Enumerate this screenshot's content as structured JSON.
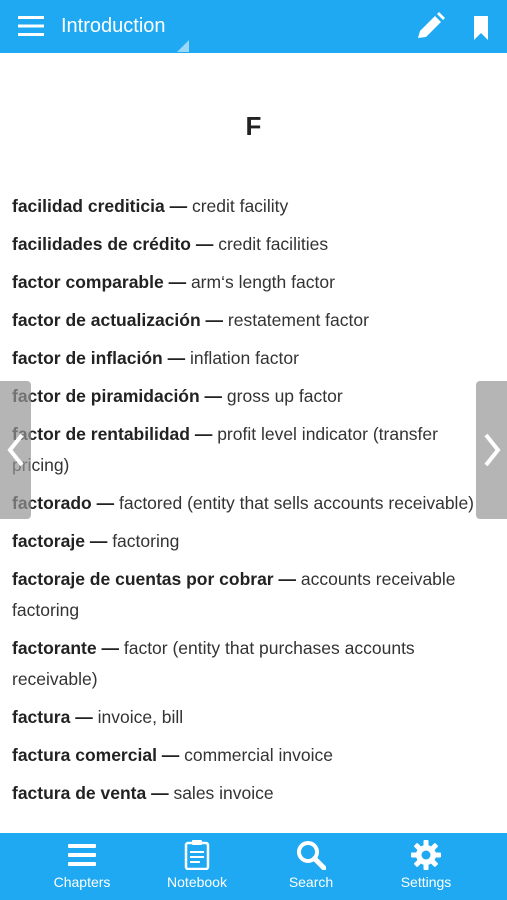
{
  "header": {
    "title": "Introduction"
  },
  "content": {
    "section_letter": "F",
    "entries": [
      {
        "term": "facilidad crediticia",
        "definition": "credit facility"
      },
      {
        "term": "facilidades de crédito",
        "definition": "credit facilities"
      },
      {
        "term": "factor comparable",
        "definition": "arm‘s length factor"
      },
      {
        "term": "factor de actualización",
        "definition": "restatement factor"
      },
      {
        "term": "factor de inflación",
        "definition": "inflation factor"
      },
      {
        "term": "factor de piramidación",
        "definition": "gross up factor"
      },
      {
        "term": "factor de rentabilidad",
        "definition": "profit level indicator (transfer pricing)"
      },
      {
        "term": "factorado",
        "definition": "factored (entity that sells accounts receivable)"
      },
      {
        "term": "factoraje",
        "definition": "factoring"
      },
      {
        "term": "factoraje de cuentas por cobrar",
        "definition": "accounts receivable factoring"
      },
      {
        "term": "factorante",
        "definition": "factor (entity that purchases accounts receivable)"
      },
      {
        "term": "factura",
        "definition": "invoice, bill"
      },
      {
        "term": "factura comercial",
        "definition": "commercial invoice"
      },
      {
        "term": "factura de venta",
        "definition": "sales invoice"
      }
    ],
    "separator": " — "
  },
  "bottom_nav": {
    "items": [
      {
        "label": "Chapters",
        "icon": "list-icon"
      },
      {
        "label": "Notebook",
        "icon": "notebook-icon"
      },
      {
        "label": "Search",
        "icon": "search-icon"
      },
      {
        "label": "Settings",
        "icon": "gear-icon"
      }
    ]
  },
  "colors": {
    "accent": "#1ea9f2",
    "side_arrow": "#969696"
  }
}
